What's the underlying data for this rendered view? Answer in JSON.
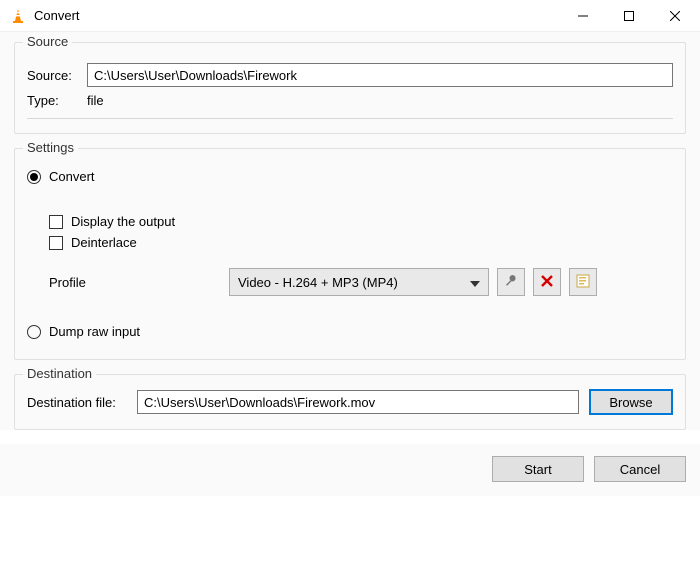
{
  "window": {
    "title": "Convert"
  },
  "source": {
    "legend": "Source",
    "source_label": "Source:",
    "source_value": "C:\\Users\\User\\Downloads\\Firework",
    "type_label": "Type:",
    "type_value": "file"
  },
  "settings": {
    "legend": "Settings",
    "convert_label": "Convert",
    "display_output_label": "Display the output",
    "deinterlace_label": "Deinterlace",
    "profile_label": "Profile",
    "profile_value": "Video - H.264 + MP3 (MP4)",
    "dump_raw_label": "Dump raw input"
  },
  "destination": {
    "legend": "Destination",
    "dest_label": "Destination file:",
    "dest_value": "C:\\Users\\User\\Downloads\\Firework.mov",
    "browse_label": "Browse"
  },
  "footer": {
    "start_label": "Start",
    "cancel_label": "Cancel"
  }
}
